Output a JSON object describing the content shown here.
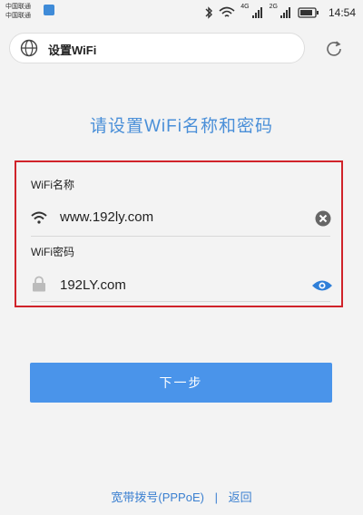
{
  "status_bar": {
    "carrier_1": "中国联通",
    "carrier_2": "中国联通",
    "network_1": "4G",
    "network_2": "2G",
    "time": "14:54"
  },
  "address_bar": {
    "title": "设置WiFi"
  },
  "heading": "请设置WiFi名称和密码",
  "form": {
    "ssid_label": "WiFi名称",
    "ssid_value": "www.192ly.com",
    "password_label": "WiFi密码",
    "password_value": "192LY.com"
  },
  "next_button": "下一步",
  "footer": {
    "pppoe_link": "宽带拨号(PPPoE)",
    "separator": "|",
    "back_link": "返回"
  },
  "colors": {
    "accent": "#4a94ea",
    "highlight_border": "#d0232a",
    "heading": "#4a8fd8"
  }
}
